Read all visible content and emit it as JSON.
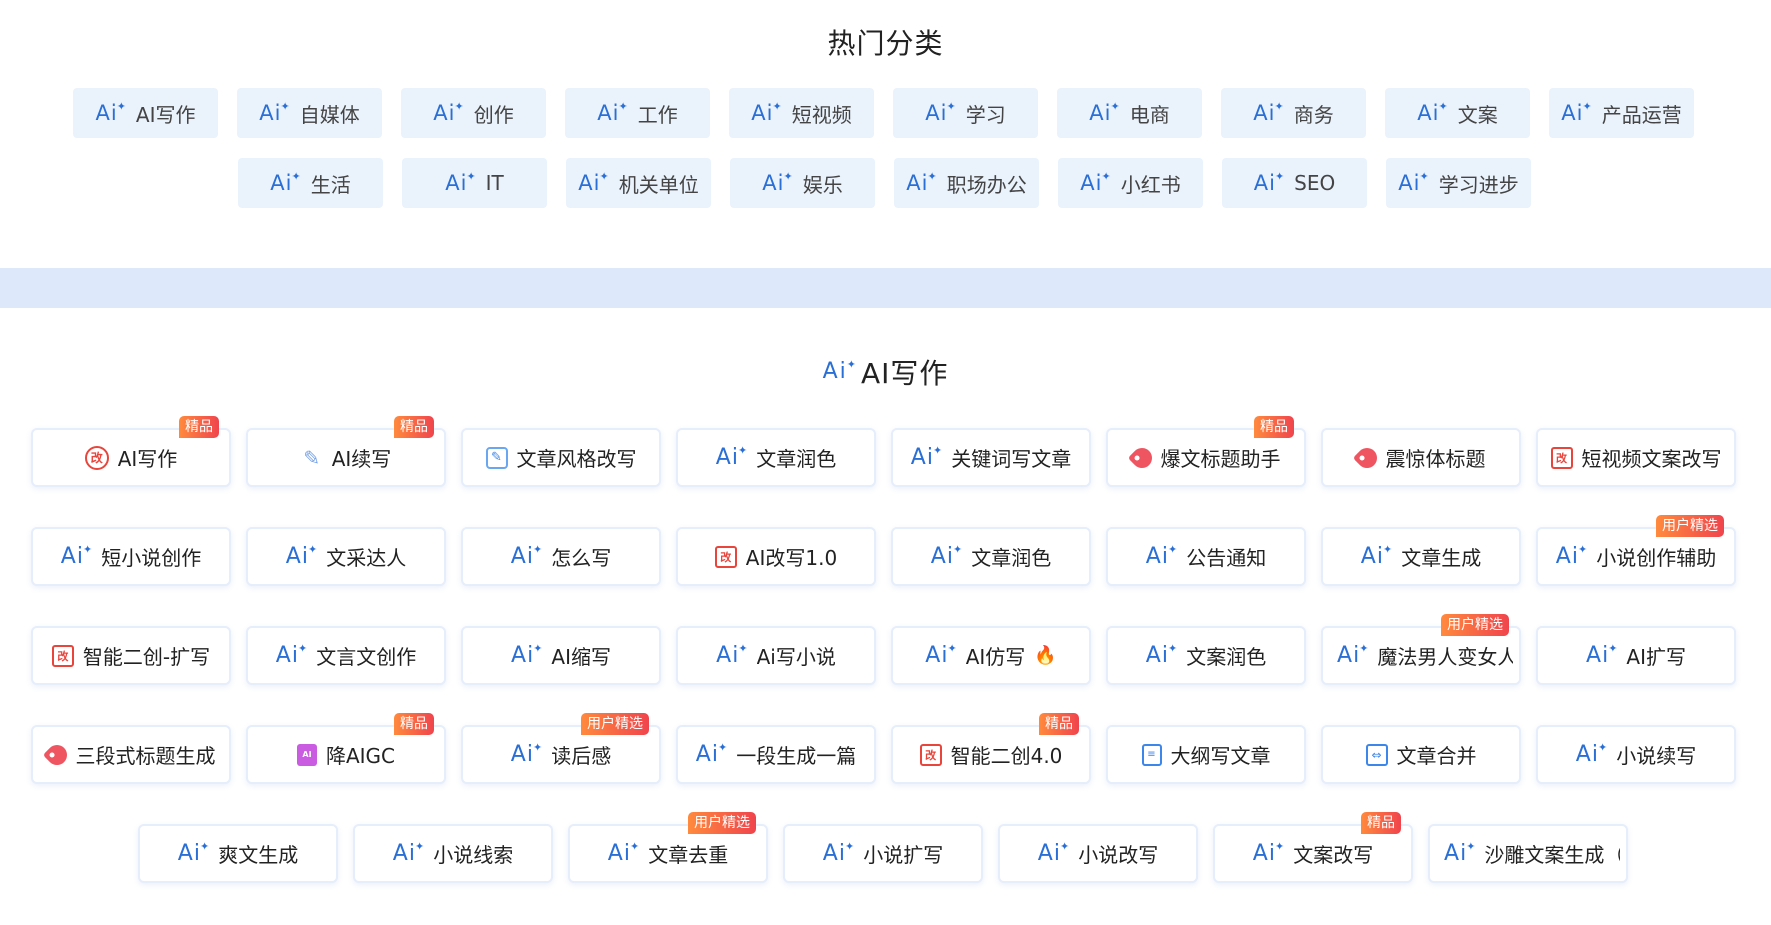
{
  "hot_section": {
    "title": "热门分类",
    "categories_row1": [
      "AI写作",
      "自媒体",
      "创作",
      "工作",
      "短视频",
      "学习",
      "电商",
      "商务",
      "文案",
      "产品运营"
    ],
    "categories_row2": [
      "生活",
      "IT",
      "机关单位",
      "娱乐",
      "职场办公",
      "小红书",
      "SEO",
      "学习进步"
    ]
  },
  "ai_section": {
    "title": "AI写作",
    "rows": [
      [
        {
          "label": "AI写作",
          "icon": "gai-circle-icon",
          "badge": "精品"
        },
        {
          "label": "AI续写",
          "icon": "pen-icon",
          "badge": "精品"
        },
        {
          "label": "文章风格改写",
          "icon": "edit-icon",
          "badge": ""
        },
        {
          "label": "文章润色",
          "icon": "ai-icon",
          "badge": ""
        },
        {
          "label": "关键词写文章",
          "icon": "ai-icon",
          "badge": ""
        },
        {
          "label": "爆文标题助手",
          "icon": "tag-icon",
          "badge": "精品"
        },
        {
          "label": "震惊体标题",
          "icon": "tag-icon",
          "badge": ""
        },
        {
          "label": "短视频文案改写",
          "icon": "gai-square-icon",
          "badge": ""
        }
      ],
      [
        {
          "label": "短小说创作",
          "icon": "ai-icon",
          "badge": ""
        },
        {
          "label": "文采达人",
          "icon": "ai-icon",
          "badge": ""
        },
        {
          "label": "怎么写",
          "icon": "ai-icon",
          "badge": ""
        },
        {
          "label": "AI改写1.0",
          "icon": "gai-square-icon",
          "badge": ""
        },
        {
          "label": "文章润色",
          "icon": "ai-icon",
          "badge": ""
        },
        {
          "label": "公告通知",
          "icon": "ai-icon",
          "badge": ""
        },
        {
          "label": "文章生成",
          "icon": "ai-icon",
          "badge": ""
        },
        {
          "label": "小说创作辅助",
          "icon": "ai-icon",
          "badge": "用户精选"
        }
      ],
      [
        {
          "label": "智能二创-扩写",
          "icon": "gai-square-icon",
          "badge": ""
        },
        {
          "label": "文言文创作",
          "icon": "ai-icon",
          "badge": ""
        },
        {
          "label": "AI缩写",
          "icon": "ai-icon",
          "badge": ""
        },
        {
          "label": "Ai写小说",
          "icon": "ai-icon",
          "badge": ""
        },
        {
          "label": "AI仿写",
          "icon": "ai-icon",
          "badge": "",
          "fire": true
        },
        {
          "label": "文案润色",
          "icon": "ai-icon",
          "badge": ""
        },
        {
          "label": "魔法男人变女人小",
          "icon": "ai-icon",
          "badge": "用户精选"
        },
        {
          "label": "AI扩写",
          "icon": "ai-icon",
          "badge": ""
        }
      ],
      [
        {
          "label": "三段式标题生成",
          "icon": "tag-icon",
          "badge": ""
        },
        {
          "label": "降AIGC",
          "icon": "aigc-icon",
          "badge": "精品"
        },
        {
          "label": "读后感",
          "icon": "ai-icon",
          "badge": "用户精选"
        },
        {
          "label": "一段生成一篇",
          "icon": "ai-icon",
          "badge": ""
        },
        {
          "label": "智能二创4.0",
          "icon": "gai-square-icon",
          "badge": "精品"
        },
        {
          "label": "大纲写文章",
          "icon": "outline-icon",
          "badge": ""
        },
        {
          "label": "文章合并",
          "icon": "merge-icon",
          "badge": ""
        },
        {
          "label": "小说续写",
          "icon": "ai-icon",
          "badge": ""
        }
      ],
      [
        {
          "label": "爽文生成",
          "icon": "ai-icon",
          "badge": ""
        },
        {
          "label": "小说线索",
          "icon": "ai-icon",
          "badge": ""
        },
        {
          "label": "文章去重",
          "icon": "ai-icon",
          "badge": "用户精选"
        },
        {
          "label": "小说扩写",
          "icon": "ai-icon",
          "badge": ""
        },
        {
          "label": "小说改写",
          "icon": "ai-icon",
          "badge": ""
        },
        {
          "label": "文案改写",
          "icon": "ai-icon",
          "badge": "精品"
        },
        {
          "label": "沙雕文案生成（小",
          "icon": "ai-icon",
          "badge": ""
        }
      ]
    ]
  },
  "colors": {
    "accent": "#2a6fd6",
    "chip_bg": "#eaf2fc",
    "band": "#dde8fb",
    "badge_from": "#ff8a3d",
    "badge_to": "#f0444d"
  }
}
